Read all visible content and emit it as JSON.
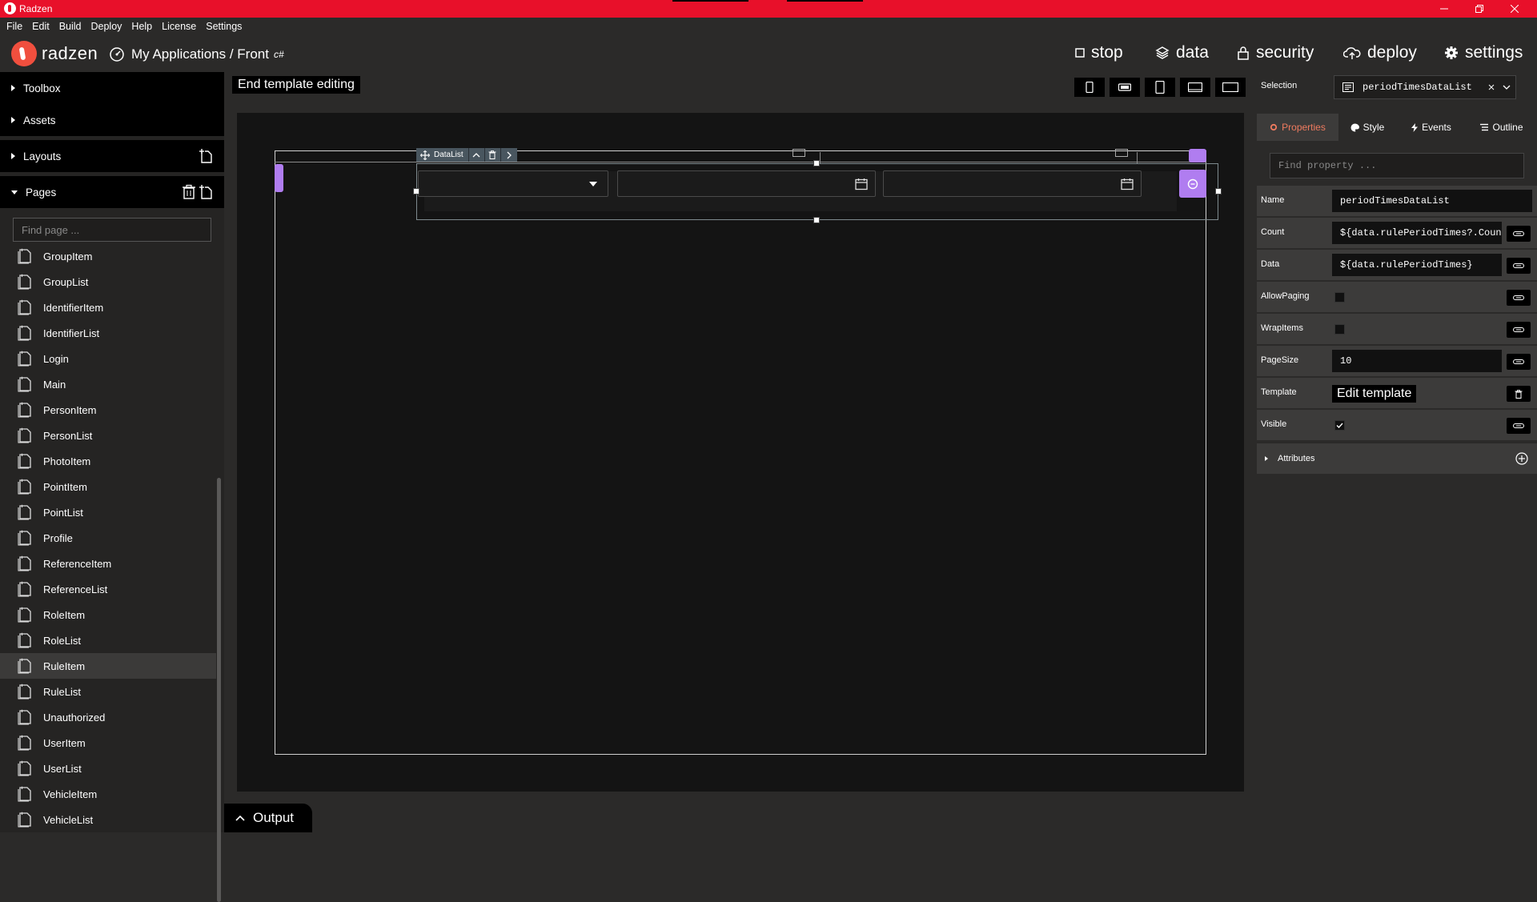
{
  "window": {
    "title": "Radzen"
  },
  "menu": {
    "items": [
      "File",
      "Edit",
      "Build",
      "Deploy",
      "Help",
      "License",
      "Settings"
    ]
  },
  "header": {
    "logo_text": "radzen",
    "breadcrumb": "My Applications / Front",
    "language_badge": "c#",
    "actions": {
      "stop": "stop",
      "data": "data",
      "security": "security",
      "deploy": "deploy",
      "settings": "settings"
    }
  },
  "sidebar": {
    "toolbox": "Toolbox",
    "assets": "Assets",
    "layouts": "Layouts",
    "pages": "Pages",
    "find_placeholder": "Find page ...",
    "page_items": [
      "GroupItem",
      "GroupList",
      "IdentifierItem",
      "IdentifierList",
      "Login",
      "Main",
      "PersonItem",
      "PersonList",
      "PhotoItem",
      "PointItem",
      "PointList",
      "Profile",
      "ReferenceItem",
      "ReferenceList",
      "RoleItem",
      "RoleList",
      "RuleItem",
      "RuleList",
      "Unauthorized",
      "UserItem",
      "UserList",
      "VehicleItem",
      "VehicleList"
    ],
    "active_page": "RuleItem"
  },
  "designer": {
    "end_template_label": "End template editing",
    "datalist_label": "DataList"
  },
  "output": {
    "label": "Output"
  },
  "properties": {
    "selection_label": "Selection",
    "selection_value": "periodTimesDataList",
    "tabs": {
      "properties": "Properties",
      "style": "Style",
      "events": "Events",
      "outline": "Outline"
    },
    "find_placeholder": "Find property ...",
    "rows": {
      "name": {
        "label": "Name",
        "value": "periodTimesDataList"
      },
      "count": {
        "label": "Count",
        "value": "${data.rulePeriodTimes?.Count}"
      },
      "data": {
        "label": "Data",
        "value": "${data.rulePeriodTimes}"
      },
      "allow_paging": {
        "label": "AllowPaging"
      },
      "wrap_items": {
        "label": "WrapItems"
      },
      "page_size": {
        "label": "PageSize",
        "value": "10"
      },
      "template": {
        "label": "Template",
        "button": "Edit template"
      },
      "visible": {
        "label": "Visible"
      }
    },
    "attributes_label": "Attributes"
  },
  "colors": {
    "brand": "#e8102a",
    "accent": "#f07b5f",
    "purple": "#b07df0"
  }
}
